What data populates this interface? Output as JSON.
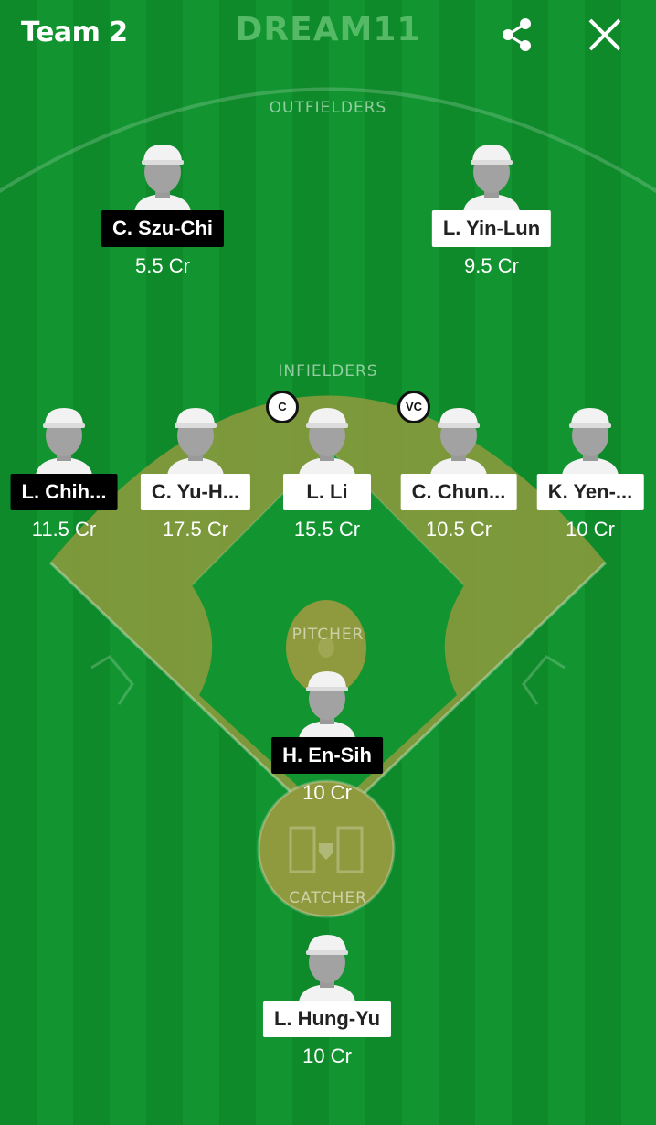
{
  "header": {
    "title": "Team 2",
    "logo": "DREAM11",
    "share_icon": "share-icon",
    "close_icon": "close-icon"
  },
  "sections": {
    "outfielders": "OUTFIELDERS",
    "infielders": "INFIELDERS",
    "pitcher": "PITCHER",
    "catcher": "CATCHER"
  },
  "players": {
    "outfielders": [
      {
        "name": "C. Szu-Chi",
        "credits": "5.5 Cr",
        "team_color": "black"
      },
      {
        "name": "L. Yin-Lun",
        "credits": "9.5 Cr",
        "team_color": "white"
      }
    ],
    "infielders": [
      {
        "name": "L. Chih...",
        "credits": "11.5 Cr",
        "team_color": "black"
      },
      {
        "name": "C. Yu-H...",
        "credits": "17.5 Cr",
        "team_color": "white"
      },
      {
        "name": "L. Li",
        "credits": "15.5 Cr",
        "team_color": "white",
        "badge": "C"
      },
      {
        "name": "C. Chun...",
        "credits": "10.5 Cr",
        "team_color": "white",
        "badge": "VC"
      },
      {
        "name": "K. Yen-...",
        "credits": "10 Cr",
        "team_color": "white"
      }
    ],
    "pitcher": [
      {
        "name": "H. En-Sih",
        "credits": "10 Cr",
        "team_color": "black"
      }
    ],
    "catcher": [
      {
        "name": "L. Hung-Yu",
        "credits": "10 Cr",
        "team_color": "white"
      }
    ]
  },
  "colors": {
    "field_green": "#129530",
    "infield_dirt": "#8a9a3a",
    "team_black": "#000000",
    "team_white": "#ffffff"
  }
}
